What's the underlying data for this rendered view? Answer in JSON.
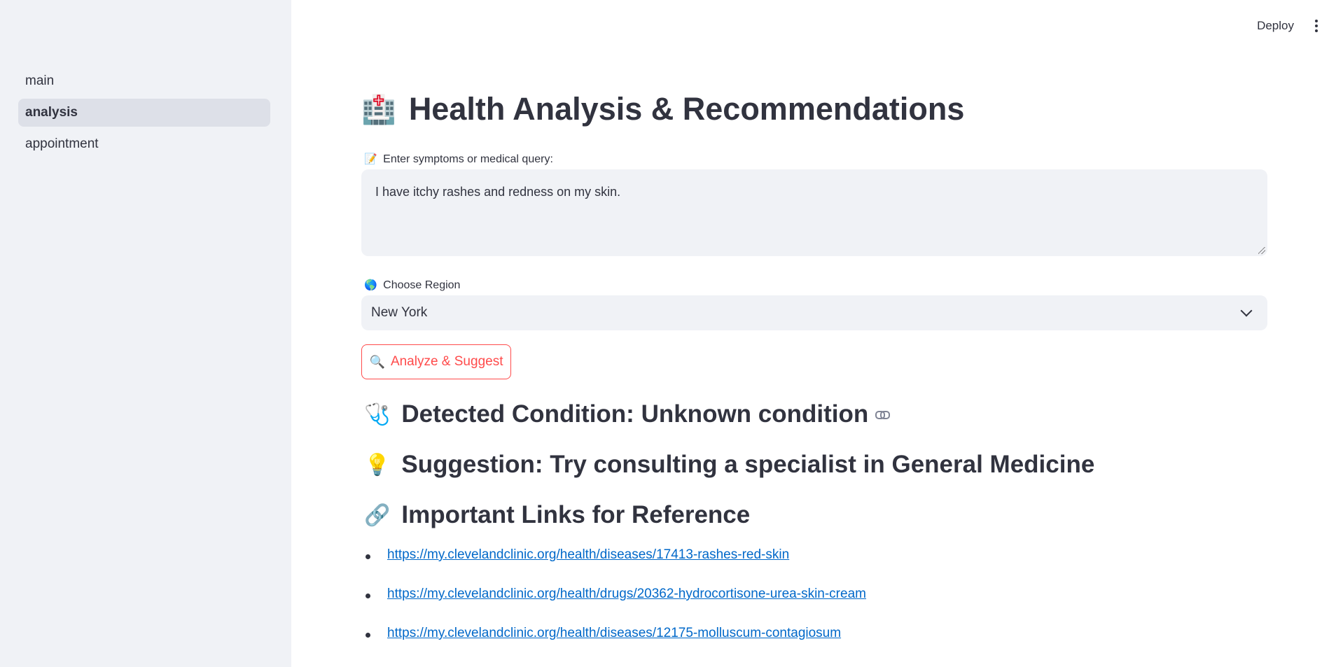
{
  "sidebar": {
    "items": [
      {
        "label": "main"
      },
      {
        "label": "analysis"
      },
      {
        "label": "appointment"
      }
    ]
  },
  "header": {
    "deploy_label": "Deploy",
    "menu_icon": "kebab-menu-icon"
  },
  "main": {
    "title_icon": "hospital-icon",
    "title": "Health Analysis & Recommendations",
    "query_label_icon": "memo-icon",
    "query_label": "Enter symptoms or medical query:",
    "query_value": "I have itchy rashes and redness on my skin.",
    "region_label_icon": "globe-icon",
    "region_label": "Choose Region",
    "region_value": "New York",
    "analyze_icon": "magnifier-icon",
    "analyze_label": "Analyze & Suggest",
    "condition_icon": "stethoscope-icon",
    "condition_heading": "Detected Condition: Unknown condition",
    "suggestion_icon": "lightbulb-icon",
    "suggestion_heading": "Suggestion: Try consulting a specialist in General Medicine",
    "links_icon": "link-icon",
    "links_heading": "Important Links for Reference",
    "links": [
      "https://my.clevelandclinic.org/health/diseases/17413-rashes-red-skin",
      "https://my.clevelandclinic.org/health/drugs/20362-hydrocortisone-urea-skin-cream",
      "https://my.clevelandclinic.org/health/diseases/12175-molluscum-contagiosum"
    ]
  },
  "colors": {
    "sidebar_bg": "#f0f2f6",
    "accent": "#ff4b4b",
    "link": "#0068c9",
    "text": "#31333f"
  }
}
